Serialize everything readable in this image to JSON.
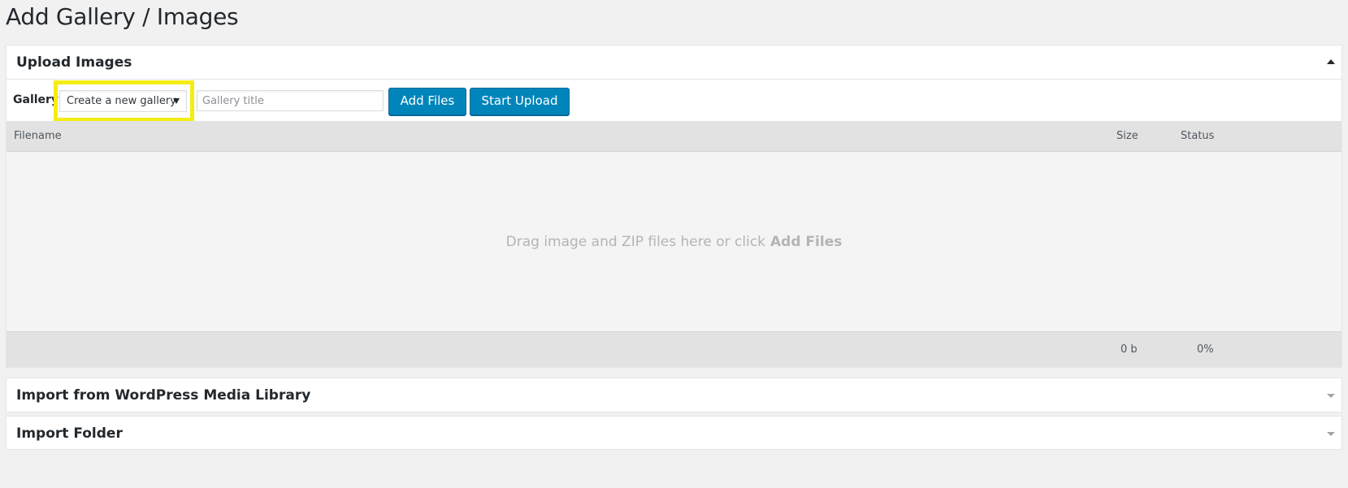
{
  "page": {
    "title": "Add Gallery / Images"
  },
  "upload_panel": {
    "title": "Upload Images",
    "gallery_label": "Gallery",
    "gallery_select": {
      "selected": "Create a new gallery"
    },
    "gallery_title_input": {
      "placeholder": "Gallery title",
      "value": ""
    },
    "add_files_label": "Add Files",
    "start_upload_label": "Start Upload",
    "table": {
      "columns": [
        "Filename",
        "Size",
        "Status"
      ],
      "drop_message": "Drag image and ZIP files here or click",
      "drop_message_action": "Add Files",
      "footer_size": "0 b",
      "footer_status": "0%"
    }
  },
  "import_media_panel": {
    "title": "Import from WordPress Media Library"
  },
  "import_folder_panel": {
    "title": "Import Folder"
  },
  "colors": {
    "button_primary": "#0085ba",
    "highlight": "#f4ed15",
    "background": "#f1f1f1"
  },
  "icons": {
    "upload_toggle": "triangle-up-icon",
    "import_media_toggle": "triangle-down-icon",
    "import_folder_toggle": "triangle-down-icon",
    "select_dropdown": "triangle-down-icon"
  }
}
